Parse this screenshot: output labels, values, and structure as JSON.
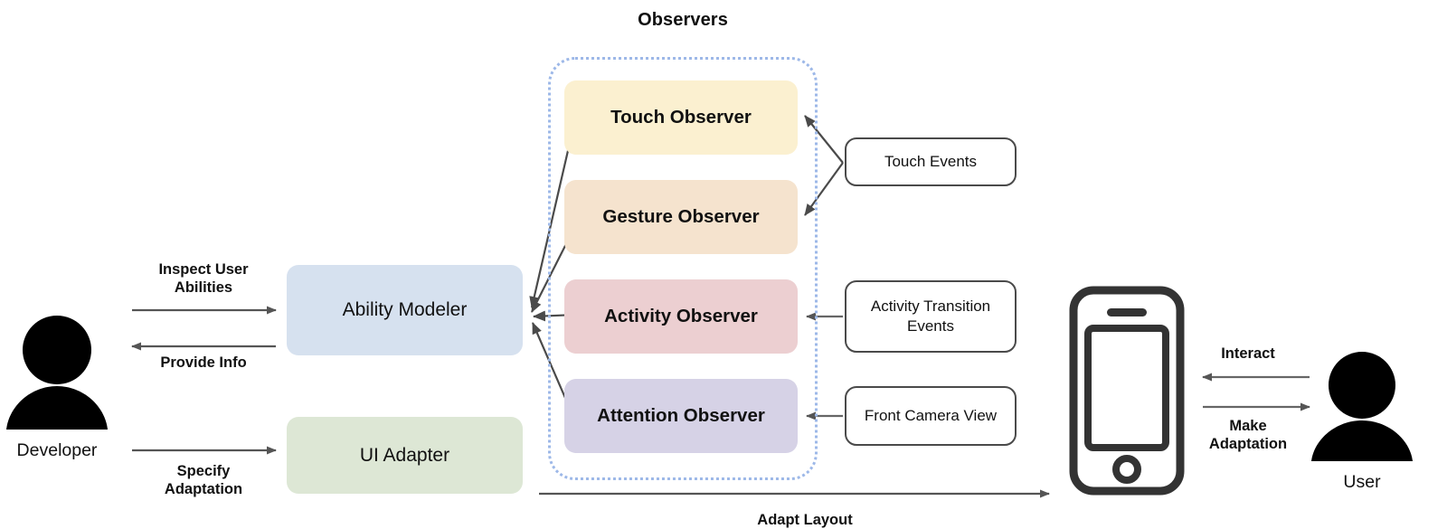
{
  "diagram": {
    "type": "system-architecture-flow",
    "observers_group": {
      "title": "Observers",
      "border_color": "#9db8e8",
      "border_style": "dotted"
    },
    "observers": [
      {
        "id": "touch",
        "label": "Touch Observer",
        "color": "#FBF0D0"
      },
      {
        "id": "gesture",
        "label": "Gesture Observer",
        "color": "#F5E3CE"
      },
      {
        "id": "activity",
        "label": "Activity Observer",
        "color": "#ECCFD1"
      },
      {
        "id": "attention",
        "label": "Attention Observer",
        "color": "#D6D2E6"
      }
    ],
    "modules": [
      {
        "id": "ability_modeler",
        "label": "Ability Modeler",
        "color": "#D6E1EF"
      },
      {
        "id": "ui_adapter",
        "label": "UI Adapter",
        "color": "#DDE7D5"
      }
    ],
    "event_sources": [
      {
        "id": "touch_events",
        "label": "Touch Events"
      },
      {
        "id": "activity_events",
        "label": "Activity\nTransition\nEvents"
      },
      {
        "id": "camera_view",
        "label": "Front\nCamera View"
      }
    ],
    "actors": [
      {
        "id": "developer",
        "label": "Developer",
        "icon": "person-icon"
      },
      {
        "id": "user",
        "label": "User",
        "icon": "person-icon"
      }
    ],
    "device": {
      "id": "phone",
      "icon": "smartphone-icon"
    },
    "edge_labels": {
      "inspect_user_abilities": "Inspect User\nAbilities",
      "provide_info": "Provide Info",
      "specify_adaptation": "Specify\nAdaptation",
      "adapt_layout": "Adapt Layout",
      "interact": "Interact",
      "make_adaptation": "Make\nAdaptation"
    },
    "colors": {
      "arrow": "#555555",
      "arrow_dark": "#3d3d3d",
      "text": "#111111",
      "box_border": "#4a4a4a",
      "device_outline": "#333333",
      "actor_fill": "#000000"
    }
  }
}
